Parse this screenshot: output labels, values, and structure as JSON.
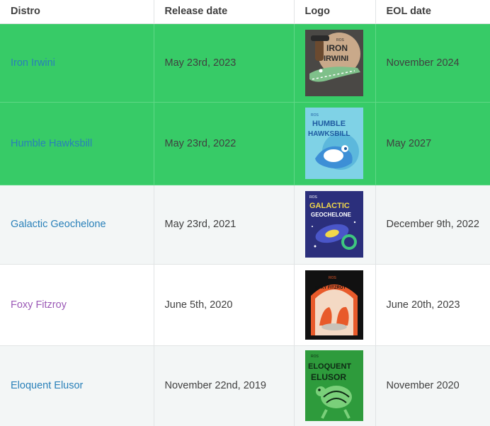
{
  "headers": {
    "distro": "Distro",
    "release": "Release date",
    "logo": "Logo",
    "eol": "EOL date"
  },
  "rows": [
    {
      "distro": "Iron Irwini",
      "release": "May 23rd, 2023",
      "eol": "November 2024",
      "logo_text": [
        "ROS",
        "IRON",
        "IRWINI"
      ],
      "logo_colors": {
        "bg": "#4a4845",
        "accent": "#c9a98a",
        "figure": "#7fc08a"
      }
    },
    {
      "distro": "Humble Hawksbill",
      "release": "May 23rd, 2022",
      "eol": "May 2027",
      "logo_text": [
        "ROS",
        "HUMBLE",
        "HAWKSBILL"
      ],
      "logo_colors": {
        "bg": "#7fd2e6",
        "accent": "#1e5aa0",
        "figure": "#3d8fd6"
      }
    },
    {
      "distro": "Galactic Geochelone",
      "release": "May 23rd, 2021",
      "eol": "December 9th, 2022",
      "logo_text": [
        "ROS",
        "GALACTIC",
        "GEOCHELONE"
      ],
      "logo_colors": {
        "bg": "#2b2f7c",
        "accent": "#f2d84a",
        "figure": "#3ec77f"
      }
    },
    {
      "distro": "Foxy Fitzroy",
      "release": "June 5th, 2020",
      "eol": "June 20th, 2023",
      "logo_text": [
        "ROS",
        "FOXY FITZROY"
      ],
      "logo_colors": {
        "bg": "#111111",
        "accent": "#e85a2a",
        "figure": "#f08050"
      }
    },
    {
      "distro": "Eloquent Elusor",
      "release": "November 22nd, 2019",
      "eol": "November 2020",
      "logo_text": [
        "ROS",
        "ELOQUENT",
        "ELUSOR"
      ],
      "logo_colors": {
        "bg": "#2e9b3c",
        "accent": "#0e2a14",
        "figure": "#7ad07a"
      }
    }
  ]
}
